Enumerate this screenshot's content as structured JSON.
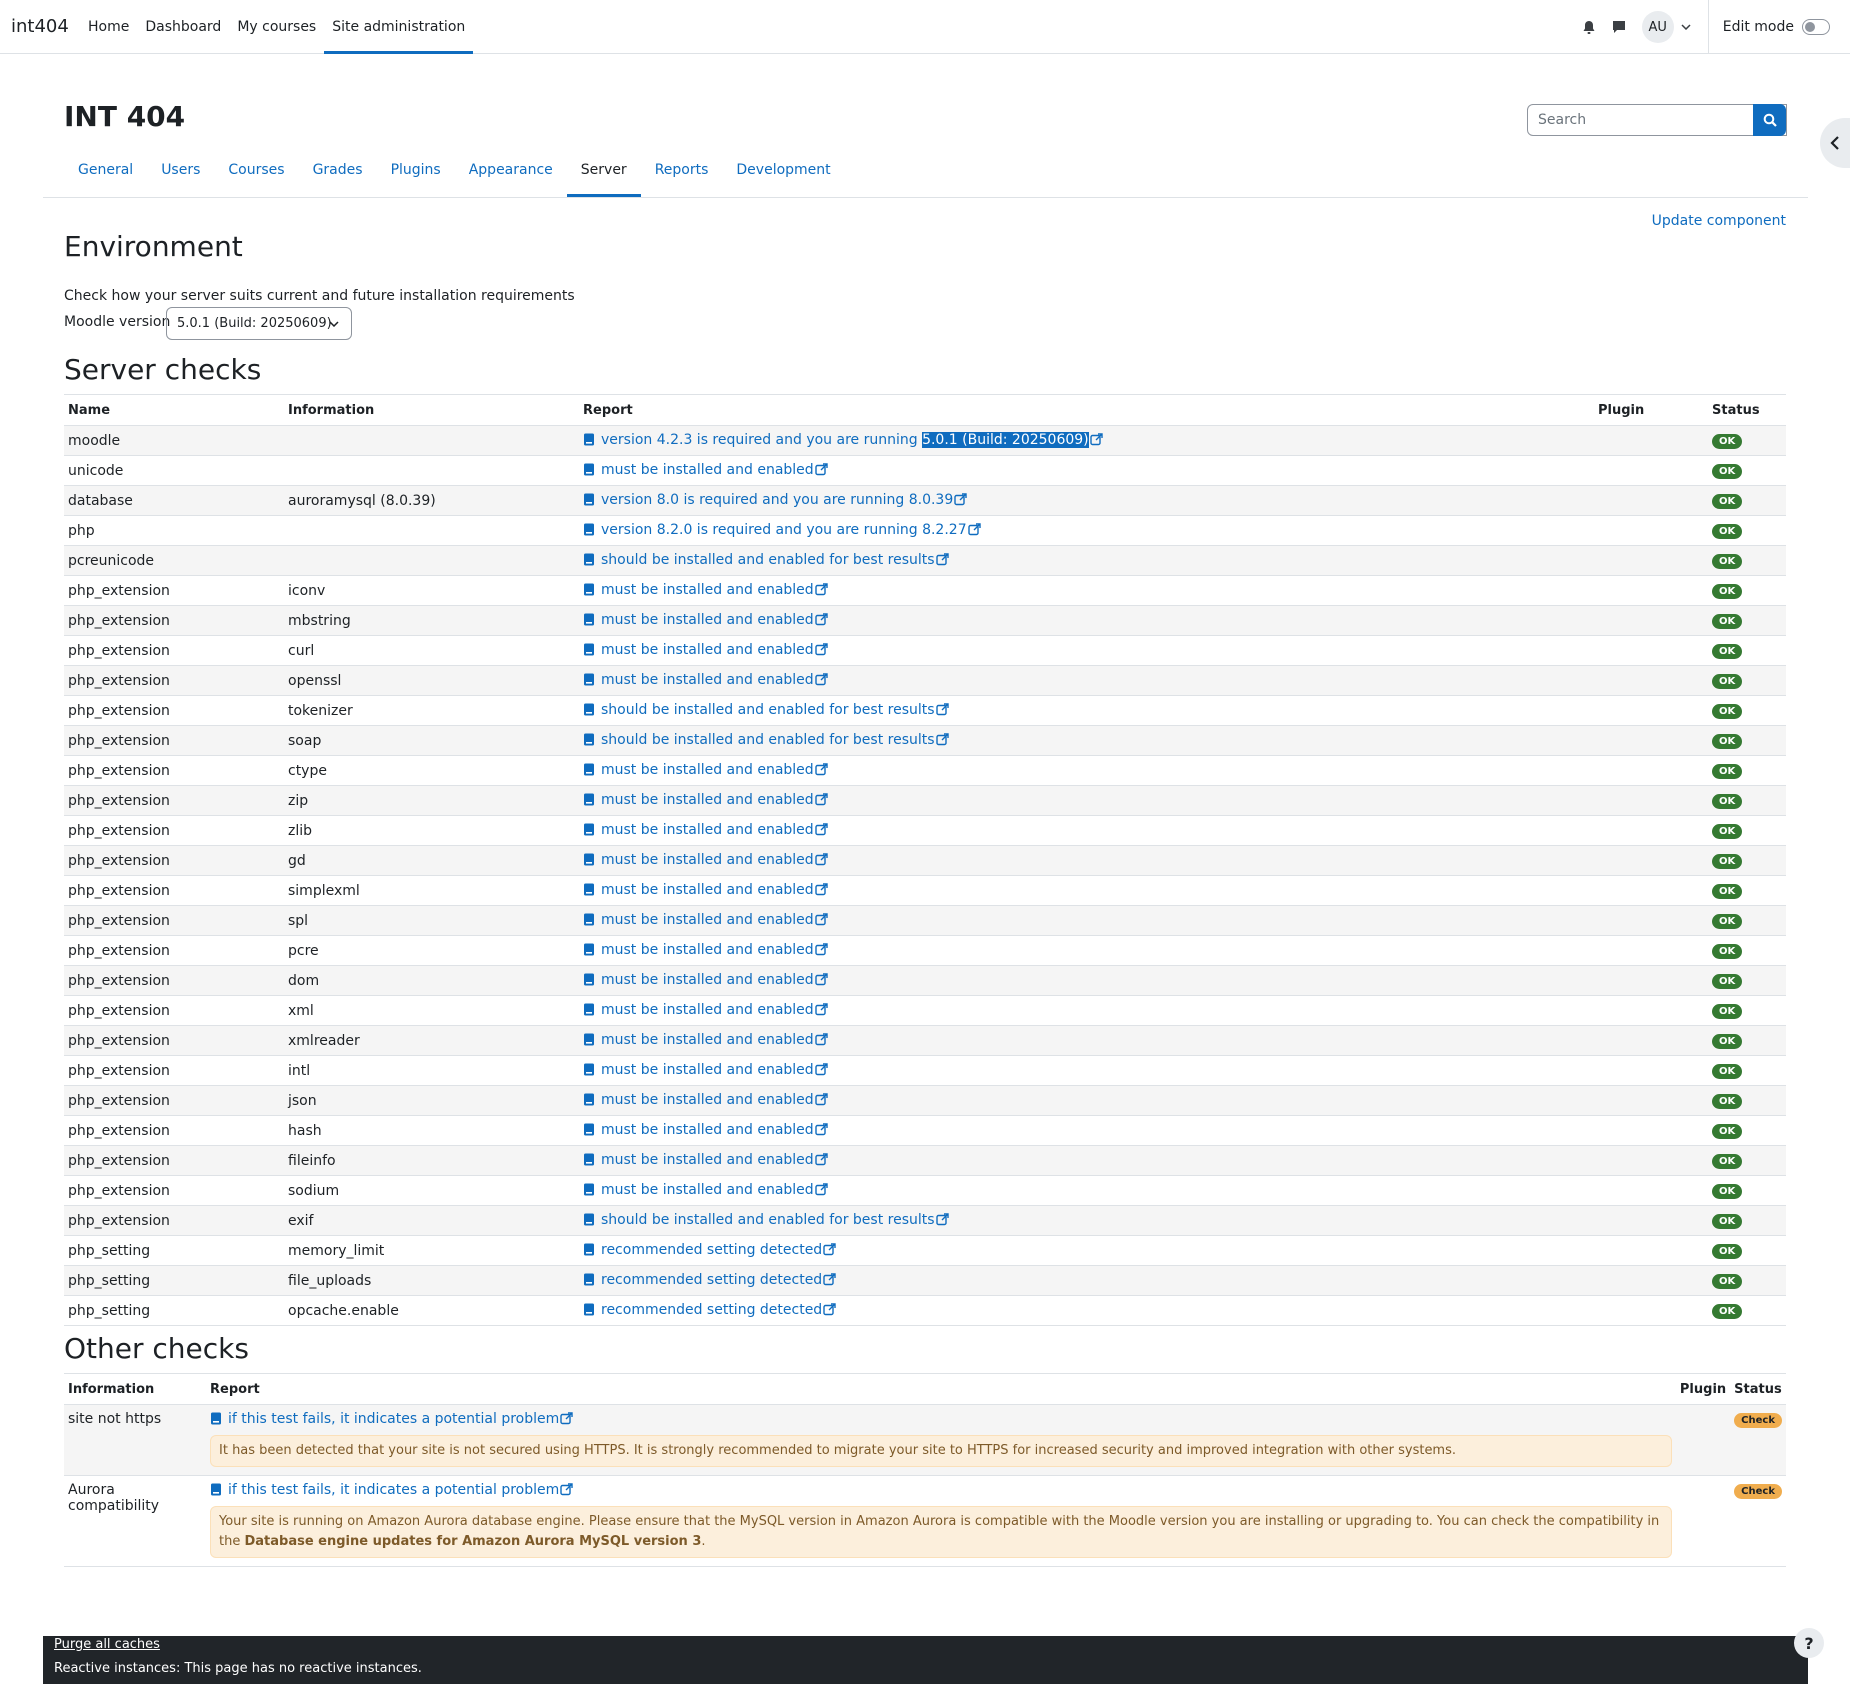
{
  "navbar": {
    "brand": "int404",
    "items": [
      {
        "label": "Home"
      },
      {
        "label": "Dashboard"
      },
      {
        "label": "My courses"
      },
      {
        "label": "Site administration"
      }
    ],
    "avatar": "AU",
    "edit_mode_label": "Edit mode"
  },
  "header": {
    "title": "INT 404",
    "search_placeholder": "Search"
  },
  "tabs": [
    {
      "label": "General"
    },
    {
      "label": "Users"
    },
    {
      "label": "Courses"
    },
    {
      "label": "Grades"
    },
    {
      "label": "Plugins"
    },
    {
      "label": "Appearance"
    },
    {
      "label": "Server"
    },
    {
      "label": "Reports"
    },
    {
      "label": "Development"
    }
  ],
  "update_component": "Update component",
  "environment": {
    "title": "Environment",
    "description": "Check how your server suits current and future installation requirements",
    "moodle_version_label": "Moodle version",
    "moodle_version_value": "5.0.1 (Build: 20250609)"
  },
  "server_checks": {
    "title": "Server checks",
    "columns": [
      "Name",
      "Information",
      "Report",
      "Plugin",
      "Status"
    ],
    "rows": [
      {
        "name": "moodle",
        "info": "",
        "report": "version 4.2.3 is required and you are running ",
        "report_highlight": "5.0.1 (Build: 20250609)",
        "status": "OK"
      },
      {
        "name": "unicode",
        "info": "",
        "report": "must be installed and enabled",
        "status": "OK"
      },
      {
        "name": "database",
        "info": "auroramysql (8.0.39)",
        "report": "version 8.0 is required and you are running 8.0.39",
        "status": "OK"
      },
      {
        "name": "php",
        "info": "",
        "report": "version 8.2.0 is required and you are running 8.2.27",
        "status": "OK"
      },
      {
        "name": "pcreunicode",
        "info": "",
        "report": "should be installed and enabled for best results",
        "status": "OK"
      },
      {
        "name": "php_extension",
        "info": "iconv",
        "report": "must be installed and enabled",
        "status": "OK"
      },
      {
        "name": "php_extension",
        "info": "mbstring",
        "report": "must be installed and enabled",
        "status": "OK"
      },
      {
        "name": "php_extension",
        "info": "curl",
        "report": "must be installed and enabled",
        "status": "OK"
      },
      {
        "name": "php_extension",
        "info": "openssl",
        "report": "must be installed and enabled",
        "status": "OK"
      },
      {
        "name": "php_extension",
        "info": "tokenizer",
        "report": "should be installed and enabled for best results",
        "status": "OK"
      },
      {
        "name": "php_extension",
        "info": "soap",
        "report": "should be installed and enabled for best results",
        "status": "OK"
      },
      {
        "name": "php_extension",
        "info": "ctype",
        "report": "must be installed and enabled",
        "status": "OK"
      },
      {
        "name": "php_extension",
        "info": "zip",
        "report": "must be installed and enabled",
        "status": "OK"
      },
      {
        "name": "php_extension",
        "info": "zlib",
        "report": "must be installed and enabled",
        "status": "OK"
      },
      {
        "name": "php_extension",
        "info": "gd",
        "report": "must be installed and enabled",
        "status": "OK"
      },
      {
        "name": "php_extension",
        "info": "simplexml",
        "report": "must be installed and enabled",
        "status": "OK"
      },
      {
        "name": "php_extension",
        "info": "spl",
        "report": "must be installed and enabled",
        "status": "OK"
      },
      {
        "name": "php_extension",
        "info": "pcre",
        "report": "must be installed and enabled",
        "status": "OK"
      },
      {
        "name": "php_extension",
        "info": "dom",
        "report": "must be installed and enabled",
        "status": "OK"
      },
      {
        "name": "php_extension",
        "info": "xml",
        "report": "must be installed and enabled",
        "status": "OK"
      },
      {
        "name": "php_extension",
        "info": "xmlreader",
        "report": "must be installed and enabled",
        "status": "OK"
      },
      {
        "name": "php_extension",
        "info": "intl",
        "report": "must be installed and enabled",
        "status": "OK"
      },
      {
        "name": "php_extension",
        "info": "json",
        "report": "must be installed and enabled",
        "status": "OK"
      },
      {
        "name": "php_extension",
        "info": "hash",
        "report": "must be installed and enabled",
        "status": "OK"
      },
      {
        "name": "php_extension",
        "info": "fileinfo",
        "report": "must be installed and enabled",
        "status": "OK"
      },
      {
        "name": "php_extension",
        "info": "sodium",
        "report": "must be installed and enabled",
        "status": "OK"
      },
      {
        "name": "php_extension",
        "info": "exif",
        "report": "should be installed and enabled for best results",
        "status": "OK"
      },
      {
        "name": "php_setting",
        "info": "memory_limit",
        "report": "recommended setting detected",
        "status": "OK"
      },
      {
        "name": "php_setting",
        "info": "file_uploads",
        "report": "recommended setting detected",
        "status": "OK"
      },
      {
        "name": "php_setting",
        "info": "opcache.enable",
        "report": "recommended setting detected",
        "status": "OK"
      }
    ]
  },
  "other_checks": {
    "title": "Other checks",
    "columns": [
      "Information",
      "Report",
      "Plugin",
      "Status"
    ],
    "rows": [
      {
        "info": "site not https",
        "report": "if this test fails, it indicates a potential problem",
        "alert": "It has been detected that your site is not secured using HTTPS. It is strongly recommended to migrate your site to HTTPS for increased security and improved integration with other systems.",
        "alert_bold": "",
        "alert_end": "",
        "status": "Check"
      },
      {
        "info": "Aurora compatibility",
        "report": "if this test fails, it indicates a potential problem",
        "alert": "Your site is running on Amazon Aurora database engine. Please ensure that the MySQL version in Amazon Aurora is compatible with the Moodle version you are installing or upgrading to. You can check the compatibility in the ",
        "alert_bold": "Database engine updates for Amazon Aurora MySQL version 3",
        "alert_end": ".",
        "status": "Check"
      }
    ]
  },
  "footer": {
    "purge": "Purge all caches",
    "reactive": "Reactive instances: This page has no reactive instances."
  },
  "help": "?",
  "colors": {
    "accent": "#0f6cbf",
    "ok": "#357a32",
    "check": "#f0ad4e",
    "footer": "#212529"
  }
}
